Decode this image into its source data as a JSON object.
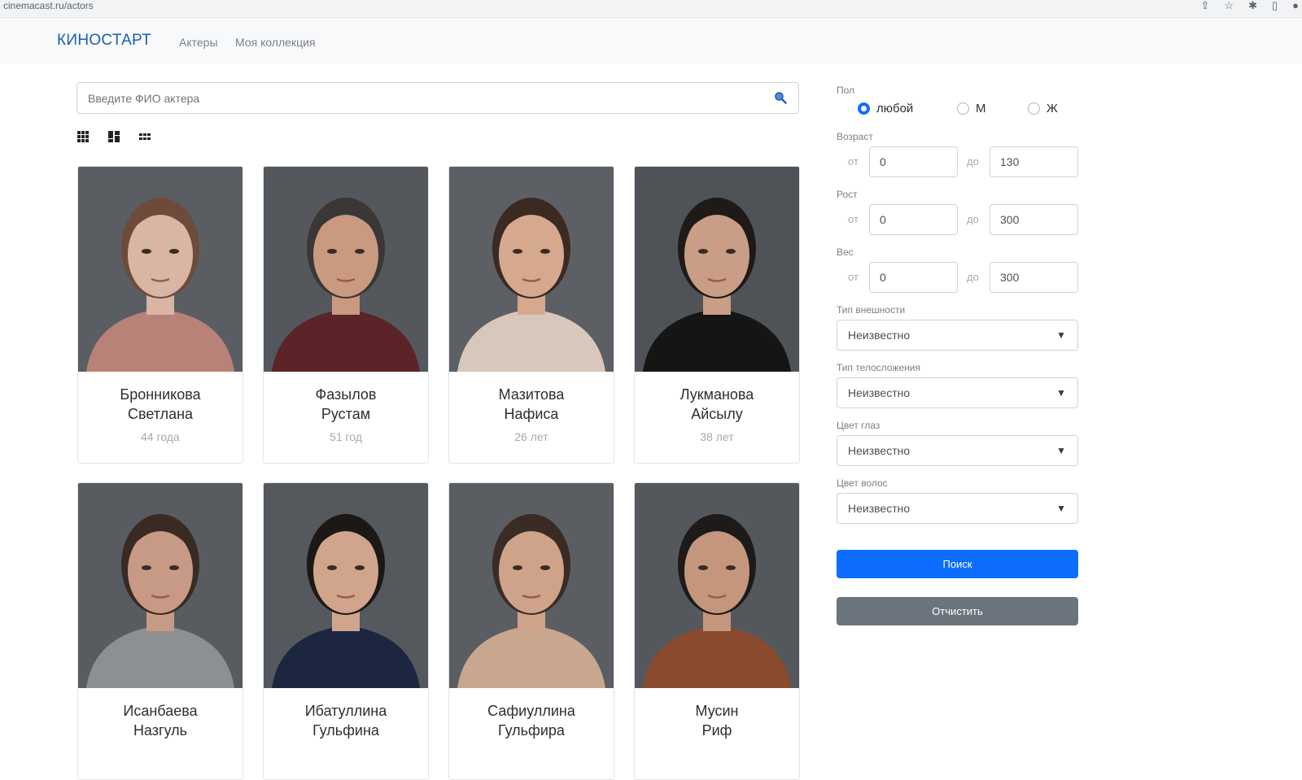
{
  "browser": {
    "url": "cinemacast.ru/actors"
  },
  "navbar": {
    "brand": "КИНОСТАРТ",
    "links": [
      "Актеры",
      "Моя коллекция"
    ]
  },
  "search": {
    "placeholder": "Введите ФИО актера"
  },
  "view_modes": [
    "grid-icon",
    "masonry-icon",
    "list-grid-icon"
  ],
  "actors": [
    {
      "surname": "Бронникова",
      "name": "Светлана",
      "age": "44 года"
    },
    {
      "surname": "Фазылов",
      "name": "Рустам",
      "age": "51 год"
    },
    {
      "surname": "Мазитова",
      "name": "Нафиса",
      "age": "26 лет"
    },
    {
      "surname": "Лукманова",
      "name": "Айсылу",
      "age": "38 лет"
    },
    {
      "surname": "Исанбаева",
      "name": "Назгуль",
      "age": ""
    },
    {
      "surname": "Ибатуллина",
      "name": "Гульфина",
      "age": ""
    },
    {
      "surname": "Сафиуллина",
      "name": "Гульфира",
      "age": ""
    },
    {
      "surname": "Мусин",
      "name": "Риф",
      "age": ""
    }
  ],
  "filters": {
    "gender": {
      "label": "Пол",
      "options": [
        "любой",
        "М",
        "Ж"
      ],
      "selected": "любой"
    },
    "age": {
      "label": "Возраст",
      "from_label": "от",
      "to_label": "до",
      "from": "0",
      "to": "130"
    },
    "height": {
      "label": "Рост",
      "from_label": "от",
      "to_label": "до",
      "from": "0",
      "to": "300"
    },
    "weight": {
      "label": "Вес",
      "from_label": "от",
      "to_label": "до",
      "from": "0",
      "to": "300"
    },
    "appearance": {
      "label": "Тип внешности",
      "value": "Неизвестно"
    },
    "body_type": {
      "label": "Тип телосложения",
      "value": "Неизвестно"
    },
    "eye_color": {
      "label": "Цвет глаз",
      "value": "Неизвестно"
    },
    "hair_color": {
      "label": "Цвет волос",
      "value": "Неизвестно"
    }
  },
  "buttons": {
    "search": "Поиск",
    "clear": "Отчистить"
  },
  "colors": {
    "primary": "#0d6efd",
    "secondary": "#6c757d",
    "brand": "#1a5fb4"
  }
}
